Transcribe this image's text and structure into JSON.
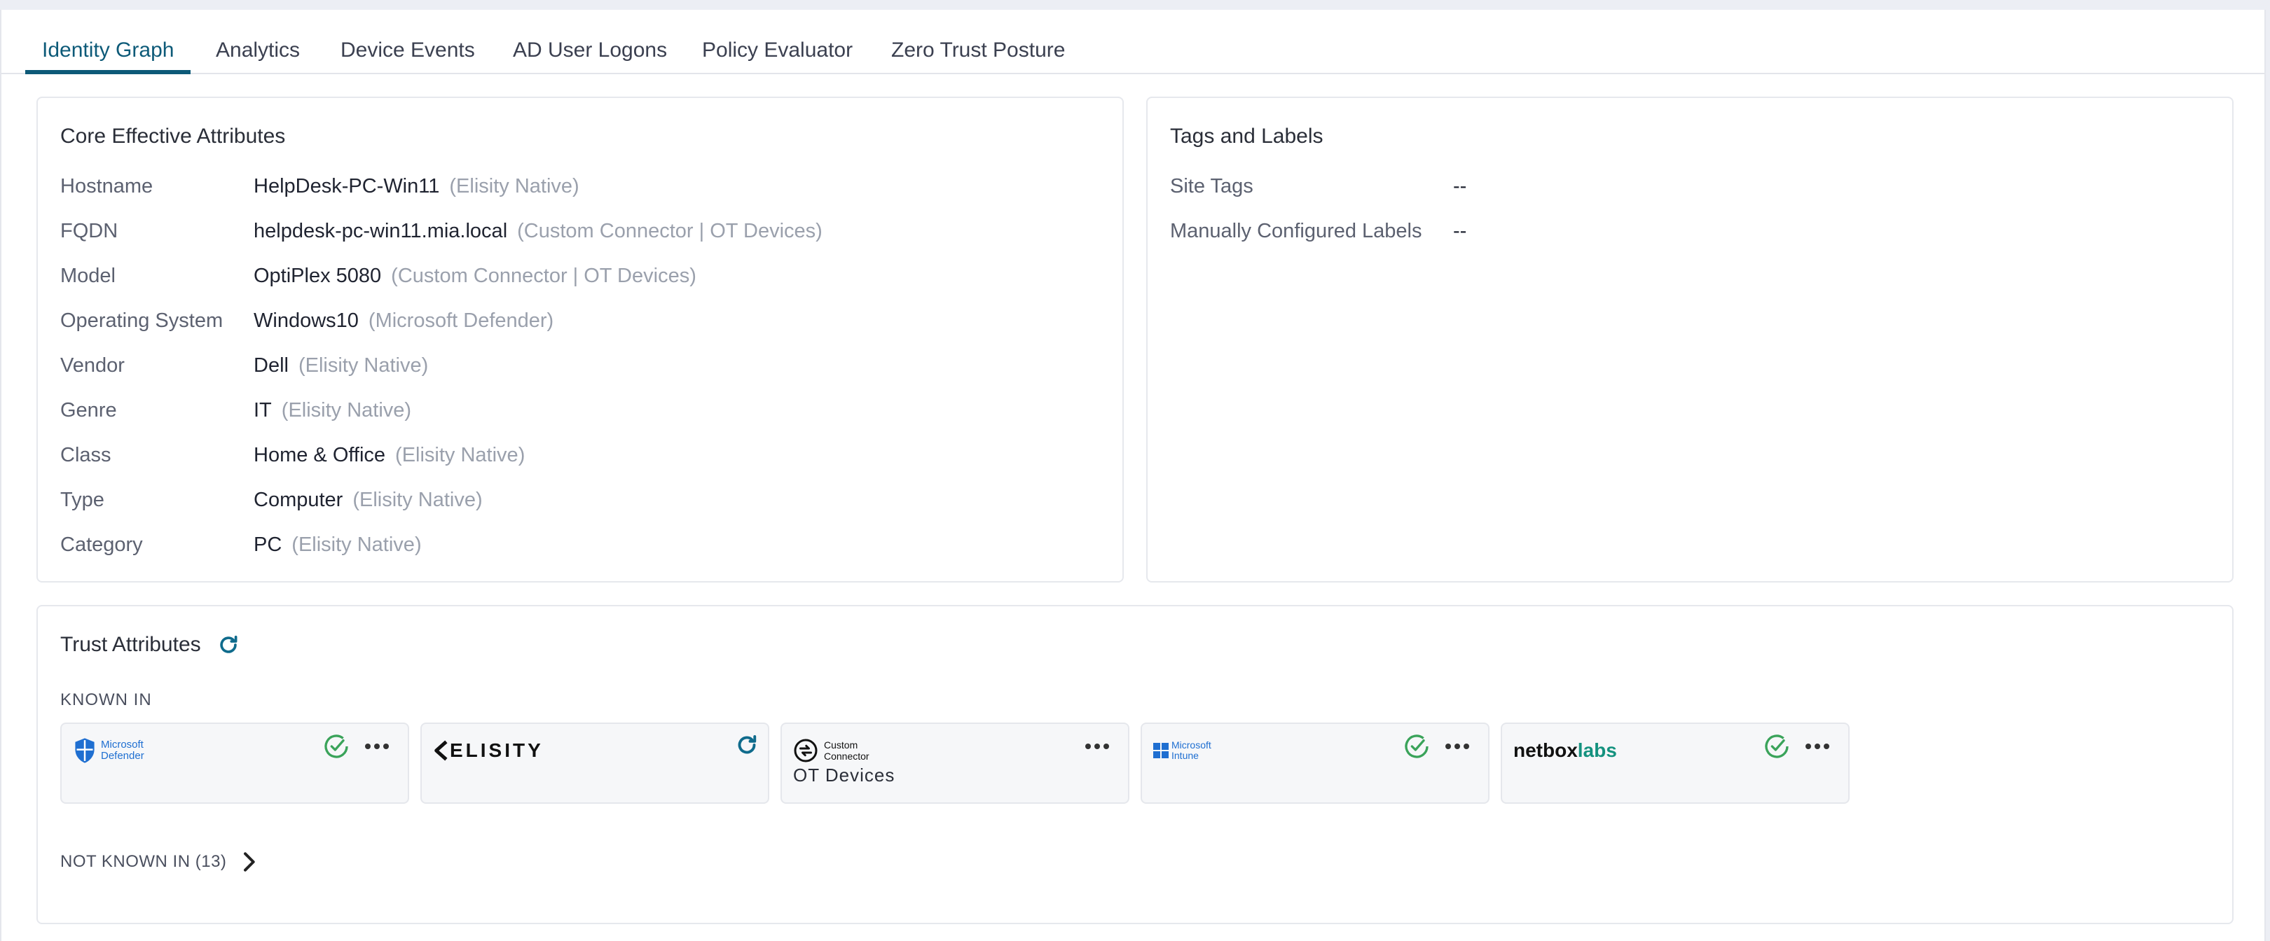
{
  "tabs": [
    {
      "label": "Identity Graph"
    },
    {
      "label": "Analytics"
    },
    {
      "label": "Device Events"
    },
    {
      "label": "AD User Logons"
    },
    {
      "label": "Policy Evaluator"
    },
    {
      "label": "Zero Trust Posture"
    }
  ],
  "active_tab": "Identity Graph",
  "core": {
    "title": "Core Effective Attributes",
    "rows": [
      {
        "label": "Hostname",
        "value": "HelpDesk-PC-Win11",
        "source": "(Elisity Native)"
      },
      {
        "label": "FQDN",
        "value": "helpdesk-pc-win11.mia.local",
        "source": "(Custom Connector | OT Devices)"
      },
      {
        "label": "Model",
        "value": "OptiPlex 5080",
        "source": "(Custom Connector | OT Devices)"
      },
      {
        "label": "Operating System",
        "value": "Windows10",
        "source": "(Microsoft Defender)"
      },
      {
        "label": "Vendor",
        "value": "Dell",
        "source": "(Elisity Native)"
      },
      {
        "label": "Genre",
        "value": "IT",
        "source": "(Elisity Native)"
      },
      {
        "label": "Class",
        "value": "Home & Office",
        "source": "(Elisity Native)"
      },
      {
        "label": "Type",
        "value": "Computer",
        "source": "(Elisity Native)"
      },
      {
        "label": "Category",
        "value": "PC",
        "source": "(Elisity Native)"
      }
    ]
  },
  "tags": {
    "title": "Tags and Labels",
    "rows": [
      {
        "label": "Site Tags",
        "value": "--"
      },
      {
        "label": "Manually Configured Labels",
        "value": "--"
      }
    ]
  },
  "trust": {
    "title": "Trust Attributes",
    "known_in_label": "KNOWN IN",
    "vendors": [
      {
        "logo_line1": "Microsoft",
        "logo_line2": "Defender",
        "sub": "",
        "status": "verified-check-icon",
        "has_more": true
      },
      {
        "logo_text": "ELISITY",
        "sub": "",
        "status": "refresh-icon",
        "has_more": false
      },
      {
        "logo_line1": "Custom",
        "logo_line2": "Connector",
        "sub": "OT Devices",
        "status": "",
        "has_more": true
      },
      {
        "logo_line1": "Microsoft",
        "logo_line2": "Intune",
        "sub": "",
        "status": "verified-check-icon",
        "has_more": true
      },
      {
        "logo_text_a": "netbox",
        "logo_text_b": "labs",
        "sub": "",
        "status": "verified-check-icon",
        "has_more": true
      }
    ],
    "not_known_label": "NOT KNOWN IN (13)"
  },
  "colors": {
    "accent": "#0d5a78",
    "check_green": "#3aa35a",
    "refresh_blue": "#0f6b8c",
    "microsoft_blue": "#1f6fd1",
    "netbox_teal": "#14927f"
  }
}
